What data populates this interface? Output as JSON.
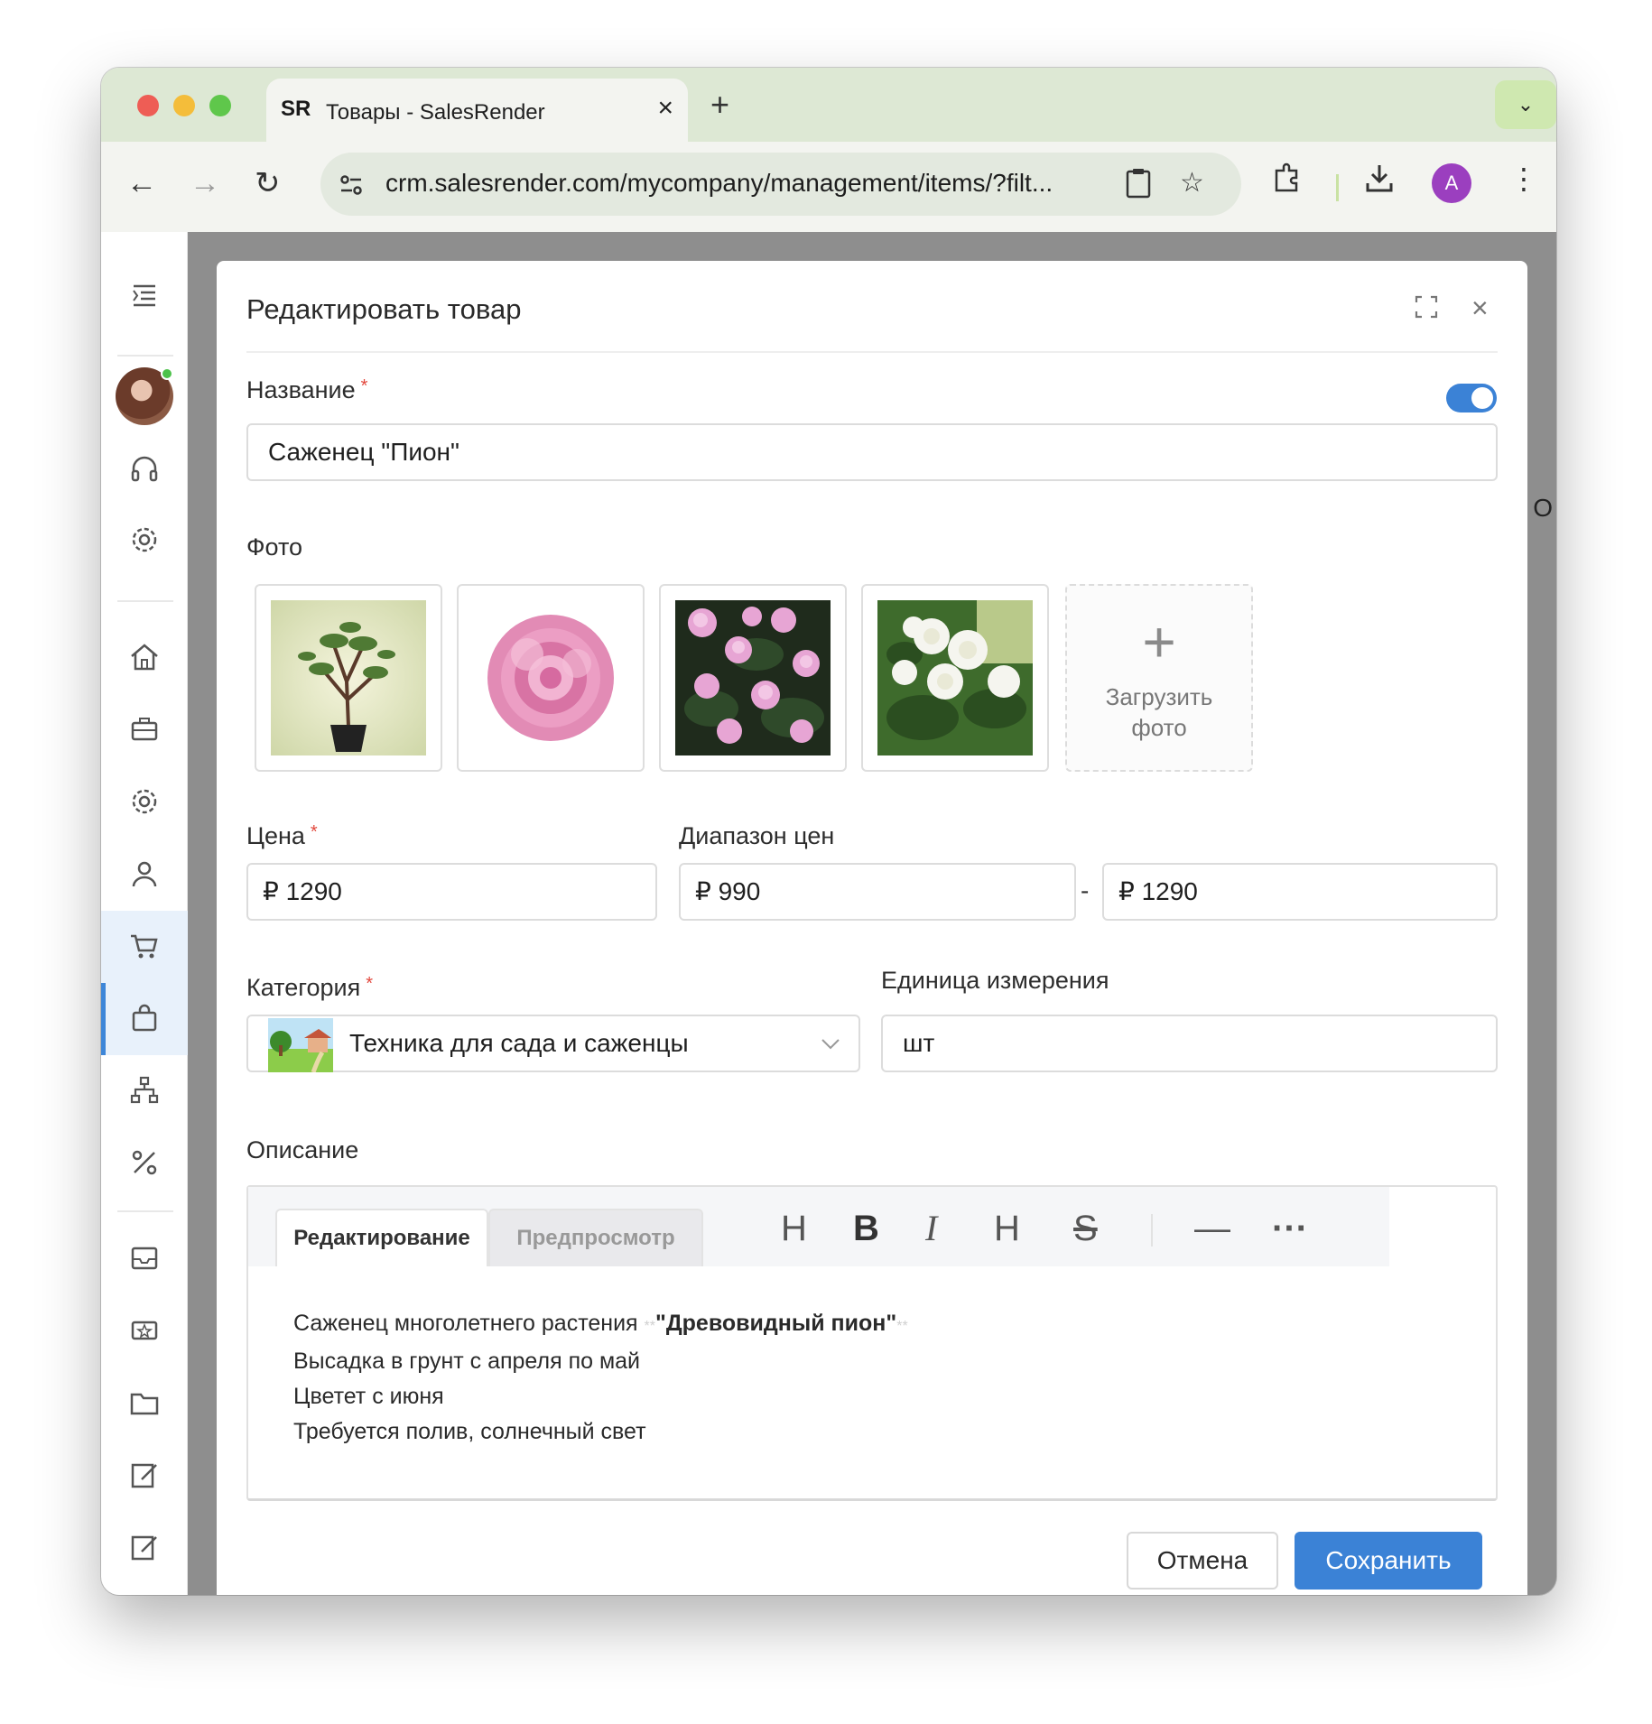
{
  "browser": {
    "tab_title": "Товары - SalesRender",
    "tab_logo": "SR",
    "url": "crm.salesrender.com/mycompany/management/items/?filt...",
    "profile_initial": "A",
    "icons": [
      "back-icon",
      "forward-icon",
      "reload-icon",
      "site-settings-icon",
      "clipboard-icon",
      "star-icon",
      "extensions-icon",
      "download-icon",
      "more-icon"
    ]
  },
  "sidebar": {
    "icons": [
      "menu-icon",
      "headset-icon",
      "settings-icon",
      "home-icon",
      "briefcase-icon",
      "gear-icon",
      "user-icon",
      "cart-icon",
      "bag-icon",
      "hierarchy-icon",
      "percent-icon",
      "inbox-icon",
      "ticket-icon",
      "folder-icon",
      "edit-icon",
      "edit-icon-2"
    ],
    "active": "bag-icon",
    "accent": "#3d86d8"
  },
  "modal": {
    "title": "Редактировать товар",
    "name_label": "Название",
    "name_value": "Саженец \"Пион\"",
    "enabled": true,
    "photo_label": "Фото",
    "photos": [
      "plant-in-pot",
      "pink-peony",
      "pink-peony-bush",
      "white-peony-bush"
    ],
    "upload_plus": "+",
    "upload_line1": "Загрузить",
    "upload_line2": "фото",
    "price_label": "Цена",
    "price_value": "₽ 1290",
    "range_label": "Диапазон цен",
    "range_from": "₽ 990",
    "range_separator": "-",
    "range_to": "₽ 1290",
    "category_label": "Категория",
    "category_value": "Техника для сада и саженцы",
    "unit_label": "Единица измерения",
    "unit_value": "шт",
    "description_label": "Описание",
    "editor": {
      "tab_edit": "Редактирование",
      "tab_preview": "Предпросмотр",
      "tools": [
        "H",
        "B",
        "I",
        "H",
        "S",
        "—",
        "···"
      ],
      "line1_prefix": "Саженец многолетнего растения ",
      "line1_md": "**",
      "line1_bold": "\"Древовидный пион\"",
      "line2": "Высадка в грунт с апреля по май",
      "line3": "Цветет с июня",
      "line4": "Требуется полив, солнечный свет"
    },
    "cancel_label": "Отмена",
    "save_label": "Сохранить",
    "primary_color": "#3b82d6",
    "required_color": "#e2483d"
  },
  "background": {
    "edge_letter": "О"
  }
}
